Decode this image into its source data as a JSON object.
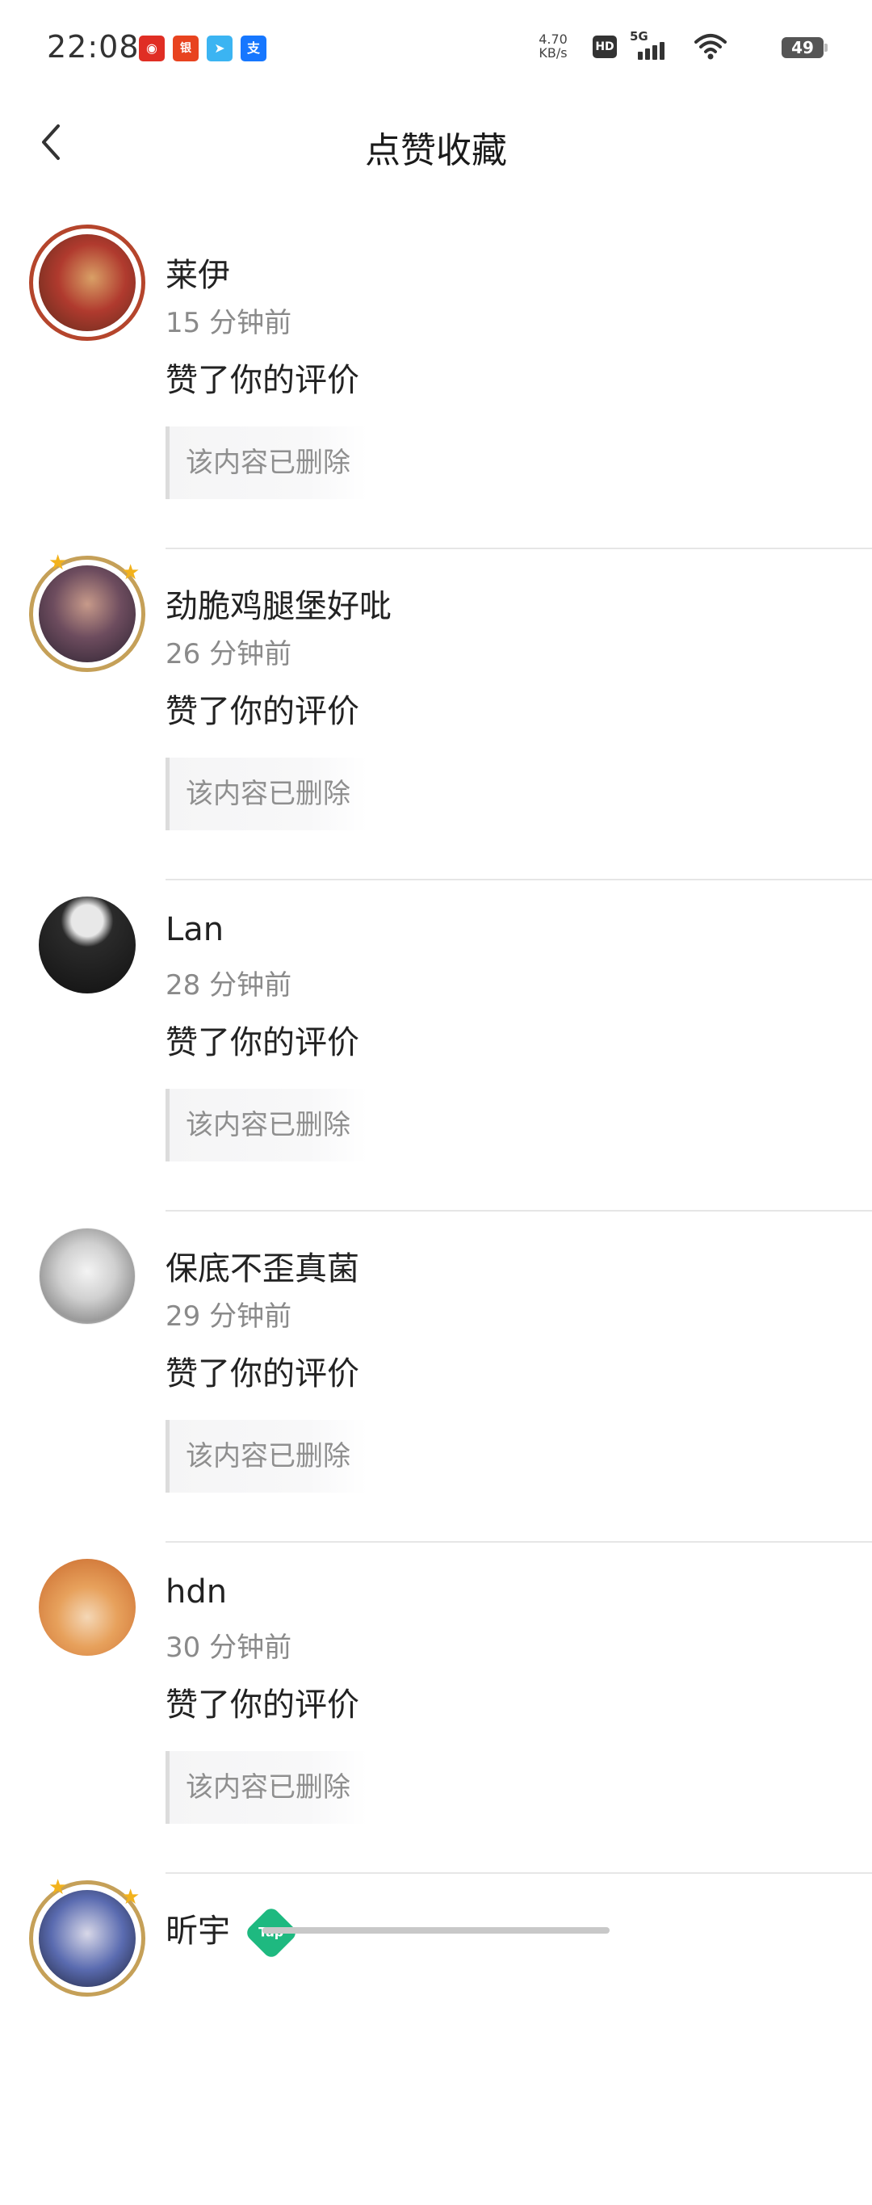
{
  "status_bar": {
    "time": "22:08",
    "app_icons": [
      {
        "name": "netease-music-icon",
        "color": "#e02e24",
        "glyph": "◉"
      },
      {
        "name": "bank-app-icon",
        "color": "#e8431f",
        "glyph": "银"
      },
      {
        "name": "maps-app-icon",
        "color": "#3bb4f2",
        "glyph": "➤"
      },
      {
        "name": "alipay-icon",
        "color": "#1677ff",
        "glyph": "支"
      }
    ],
    "net_speed_value": "4.70",
    "net_speed_unit": "KB/s",
    "hd_label": "HD",
    "network_label": "5G",
    "battery": "49"
  },
  "nav": {
    "title": "点赞收藏"
  },
  "feed": [
    {
      "name": "莱伊",
      "time_ago": "15 分钟前",
      "action": "赞了你的评价",
      "quote": "该内容已删除",
      "avatar_colors": [
        "#5a2a1a",
        "#b03a2e",
        "#d9a066"
      ]
    },
    {
      "name": "劲脆鸡腿堡好吡",
      "time_ago": "26 分钟前",
      "action": "赞了你的评价",
      "quote": "该内容已删除",
      "avatar_colors": [
        "#2b2230",
        "#6d4c5e",
        "#c79a8a"
      ]
    },
    {
      "name": "Lan",
      "time_ago": "28 分钟前",
      "action": "赞了你的评价",
      "quote": "该内容已删除",
      "avatar_colors": [
        "#111111",
        "#2a2a2a",
        "#e8e8e8"
      ]
    },
    {
      "name": "保底不歪真菌",
      "time_ago": "29 分钟前",
      "action": "赞了你的评价",
      "quote": "该内容已删除",
      "avatar_colors": [
        "#f4f4f4",
        "#9a9a9a",
        "#3a3a3a"
      ]
    },
    {
      "name": "hdn",
      "time_ago": "30 分钟前",
      "action": "赞了你的评价",
      "quote": "该内容已删除",
      "avatar_colors": [
        "#c8662a",
        "#e7a15c",
        "#f4d7b6"
      ]
    },
    {
      "name": "昕宇",
      "tag": "Tap",
      "avatar_colors": [
        "#1c2033",
        "#d8d8e8",
        "#5a6bb0"
      ]
    }
  ]
}
